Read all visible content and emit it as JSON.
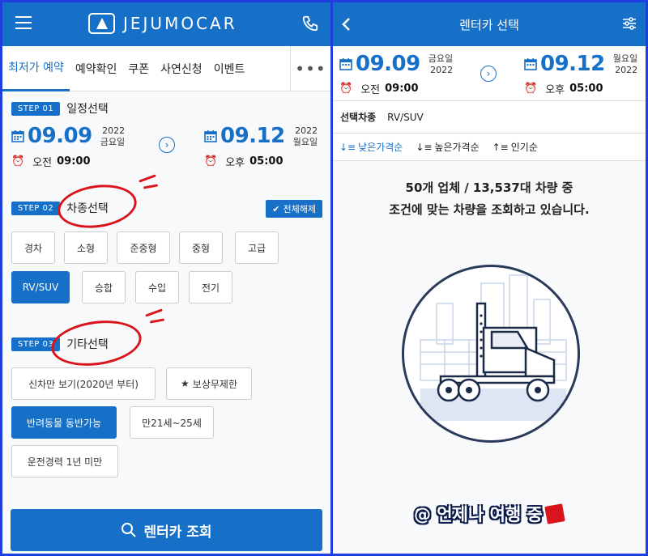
{
  "left": {
    "brand": "JEJUMOCAR",
    "tabs": [
      "최저가 예약",
      "예약확인",
      "쿠폰",
      "사연신청",
      "이벤트"
    ],
    "more": "•••",
    "step1": {
      "badge": "STEP 01",
      "title": "일정선택"
    },
    "start": {
      "date": "09.09",
      "year": "2022",
      "weekday": "금요일",
      "ampm": "오전",
      "time": "09:00"
    },
    "end": {
      "date": "09.12",
      "year": "2022",
      "weekday": "월요일",
      "ampm": "오후",
      "time": "05:00"
    },
    "step2": {
      "badge": "STEP 02",
      "title": "차종선택",
      "deselect": "전체해제"
    },
    "car_types": [
      "경차",
      "소형",
      "준중형",
      "중형",
      "고급",
      "RV/SUV",
      "승합",
      "수입",
      "전기"
    ],
    "car_selected": "RV/SUV",
    "step3": {
      "badge": "STEP 03",
      "title": "기타선택"
    },
    "options": [
      "신차만 보기(2020년 부터)",
      "보상무제한",
      "반려동물 동반가능",
      "만21세~25세",
      "운전경력 1년 미만"
    ],
    "option_selected": "반려동물 동반가능",
    "search_label": "렌터카 조회"
  },
  "right": {
    "title": "렌터카 선택",
    "start": {
      "date": "09.09",
      "weekday": "금요일",
      "year": "2022",
      "ampm": "오전",
      "time": "09:00"
    },
    "end": {
      "date": "09.12",
      "weekday": "월요일",
      "year": "2022",
      "ampm": "오후",
      "time": "05:00"
    },
    "selection_label": "선택차종",
    "selection_value": "RV/SUV",
    "sorts": [
      "낮은가격순",
      "높은가격순",
      "인기순"
    ],
    "active_sort": "낮은가격순",
    "loading_line1": "50개 업체 / 13,537대 차량 중",
    "loading_line2": "조건에 맞는 차량을 조회하고 있습니다.",
    "watermark": "@ 언제나 여행 중"
  },
  "colors": {
    "primary": "#1770c7",
    "annotation": "#d9141b",
    "frame": "#1f3fe0"
  }
}
